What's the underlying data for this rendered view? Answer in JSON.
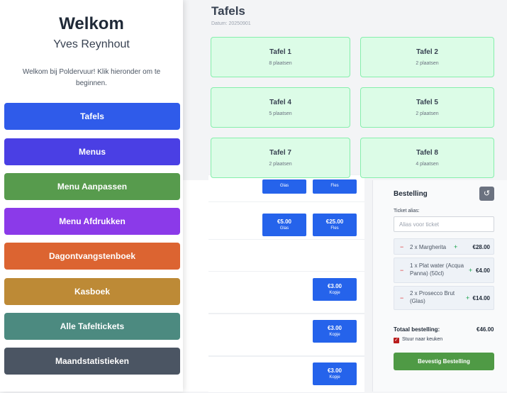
{
  "sidebar": {
    "welcome": "Welkom",
    "username": "Yves Reynhout",
    "intro": "Welkom bij Poldervuur! Klik hieronder om te beginnen.",
    "items": [
      {
        "label": "Tafels",
        "color": "#2f5bea"
      },
      {
        "label": "Menus",
        "color": "#4a3fe4"
      },
      {
        "label": "Menu Aanpassen",
        "color": "#579b4d"
      },
      {
        "label": "Menu Afdrukken",
        "color": "#8b3ae9"
      },
      {
        "label": "Dagontvangstenboek",
        "color": "#dc6431"
      },
      {
        "label": "Kasboek",
        "color": "#bd8a36"
      },
      {
        "label": "Alle Tafeltickets",
        "color": "#4c8a80"
      },
      {
        "label": "Maandstatistieken",
        "color": "#4b5563"
      }
    ]
  },
  "page": {
    "title": "Tafels",
    "date": "Datum: 20250901"
  },
  "tables": [
    {
      "name": "Tafel 1",
      "seats": "8 plaatsen"
    },
    {
      "name": "Tafel 2",
      "seats": "2 plaatsen"
    },
    {
      "name": "Tafel 4",
      "seats": "5 plaatsen"
    },
    {
      "name": "Tafel 5",
      "seats": "2 plaatsen"
    },
    {
      "name": "Tafel 7",
      "seats": "2 plaatsen"
    },
    {
      "name": "Tafel 8",
      "seats": "4 plaatsen"
    }
  ],
  "menu_buttons": {
    "row1": [
      {
        "price": "",
        "unit": "Glas"
      },
      {
        "price": "",
        "unit": "Fles"
      }
    ],
    "row2": [
      {
        "price": "€5.00",
        "unit": "Glas"
      },
      {
        "price": "€25.00",
        "unit": "Fles"
      }
    ],
    "row3": [
      {
        "price": "€3.00",
        "unit": "Kopje"
      }
    ],
    "row4": [
      {
        "price": "€3.00",
        "unit": "Kopje"
      }
    ],
    "row5": [
      {
        "price": "€3.00",
        "unit": "Kopje"
      }
    ]
  },
  "order": {
    "title": "Bestelling",
    "undo_icon": "↺",
    "alias_label": "Ticket alias:",
    "alias_placeholder": "Alias voor ticket",
    "items": [
      {
        "name": "2 x Margherita",
        "price": "€28.00"
      },
      {
        "name": "1 x Plat water (Acqua Panna) (50cl)",
        "price": "€4.00"
      },
      {
        "name": "2 x Prosecco Brut (Glas)",
        "price": "€14.00"
      }
    ],
    "total_label": "Totaal bestelling:",
    "total_value": "€46.00",
    "kitchen_label": "Stuur naar keuken",
    "confirm_label": "Bevestig Bestelling"
  }
}
